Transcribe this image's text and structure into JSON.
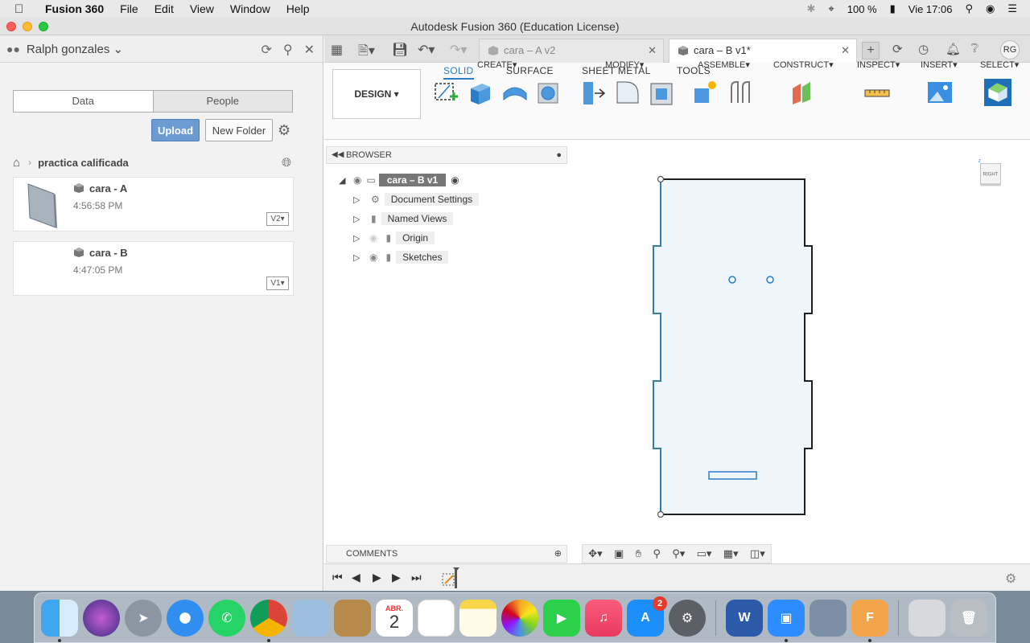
{
  "menubar": {
    "app": "Fusion 360",
    "items": [
      "File",
      "Edit",
      "View",
      "Window",
      "Help"
    ],
    "battery": "100 %",
    "clock": "Vie 17:06"
  },
  "window": {
    "title": "Autodesk Fusion 360 (Education License)"
  },
  "datapanel": {
    "user": "Ralph gonzales",
    "tabs": {
      "data": "Data",
      "people": "People"
    },
    "upload_label": "Upload",
    "new_folder_label": "New Folder",
    "breadcrumb_folder": "practica calificada",
    "files": [
      {
        "name": "cara - A",
        "time": "4:56:58 PM",
        "version": "V2"
      },
      {
        "name": "cara - B",
        "time": "4:47:05 PM",
        "version": "V1"
      }
    ]
  },
  "tabs": {
    "inactive": "cara – A v2",
    "active": "cara – B v1*",
    "avatar": "RG"
  },
  "ribbon": {
    "design": "DESIGN",
    "tabs": [
      "SOLID",
      "SURFACE",
      "SHEET METAL",
      "TOOLS"
    ],
    "groups": [
      "CREATE",
      "MODIFY",
      "ASSEMBLE",
      "CONSTRUCT",
      "INSPECT",
      "INSERT",
      "SELECT"
    ]
  },
  "browser": {
    "title": "BROWSER",
    "root": "cara – B v1",
    "items": [
      "Document Settings",
      "Named Views",
      "Origin",
      "Sketches"
    ]
  },
  "comments": {
    "title": "COMMENTS"
  },
  "viewcube": {
    "face": "RIGHT",
    "axis_z": "Z"
  },
  "dock": {
    "calendar_month": "ABR.",
    "calendar_day": "2",
    "appstore_badge": "2"
  }
}
